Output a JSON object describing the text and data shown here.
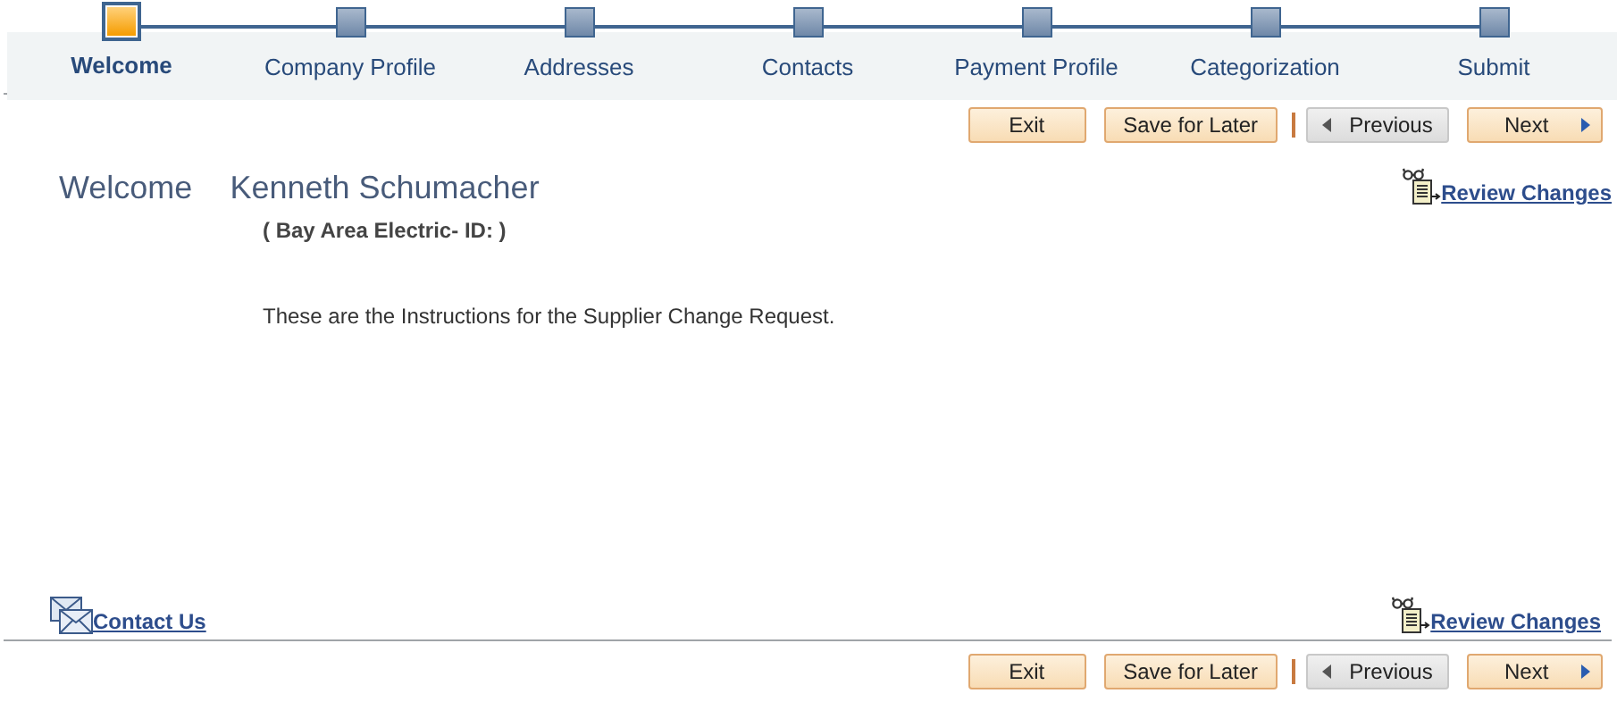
{
  "steps": [
    {
      "label": "Welcome",
      "selected": true
    },
    {
      "label": "Company Profile",
      "selected": false
    },
    {
      "label": "Addresses",
      "selected": false
    },
    {
      "label": "Contacts",
      "selected": false
    },
    {
      "label": "Payment Profile",
      "selected": false
    },
    {
      "label": "Categorization",
      "selected": false
    },
    {
      "label": "Submit",
      "selected": false
    }
  ],
  "top_buttons": [
    {
      "label": "Exit",
      "kind": "plain",
      "disabled": false
    },
    {
      "label": "Save for Later",
      "kind": "plain",
      "disabled": false
    },
    {
      "label": "Previous",
      "kind": "previous",
      "disabled": true
    },
    {
      "label": "Next",
      "kind": "next",
      "disabled": false
    }
  ],
  "greeting": "Welcome",
  "user_name": "Kenneth Schumacher",
  "supplier_line": "( Bay Area Electric-  ID:  )",
  "instructions": "These are the Instructions for the Supplier Change Request.",
  "review_link_top": "Review Changes",
  "contact_link": "Contact Us",
  "review_link_bottom": "Review Changes",
  "bottom_buttons": [
    {
      "label": "Exit",
      "kind": "plain",
      "disabled": false
    },
    {
      "label": "Save for Later",
      "kind": "plain",
      "disabled": false
    },
    {
      "label": "Previous",
      "kind": "previous",
      "disabled": true
    },
    {
      "label": "Next",
      "kind": "next",
      "disabled": false
    }
  ]
}
